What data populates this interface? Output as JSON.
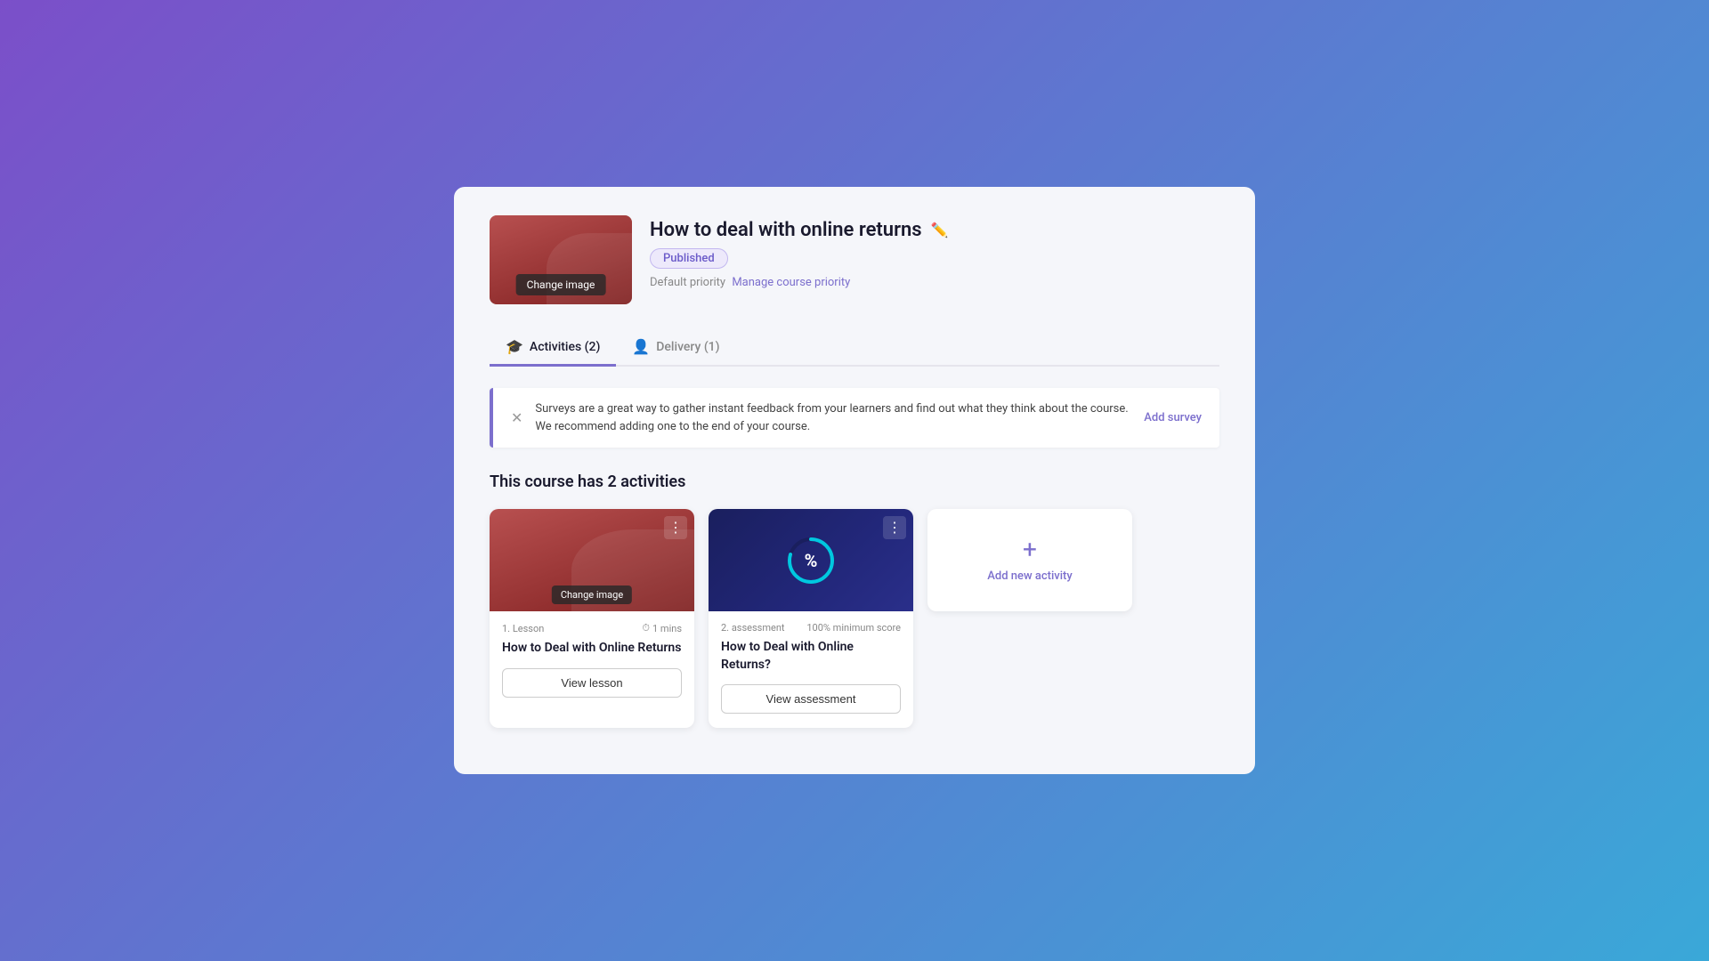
{
  "page": {
    "background": "gradient-purple-blue"
  },
  "course": {
    "title": "How to deal with online returns",
    "status": "Published",
    "priority_label": "Default priority",
    "manage_priority_text": "Manage course priority",
    "change_image_label": "Change image"
  },
  "tabs": [
    {
      "id": "activities",
      "label": "Activities (2)",
      "icon": "🎓",
      "active": true
    },
    {
      "id": "delivery",
      "label": "Delivery (1)",
      "icon": "👤",
      "active": false
    }
  ],
  "banner": {
    "text": "Surveys are a great way to gather instant feedback from your learners and find out what they think about the course. We recommend adding one to the end of your course.",
    "action_label": "Add survey"
  },
  "section_title": "This course has 2 activities",
  "activities": [
    {
      "id": 1,
      "type": "Lesson",
      "number": "1.",
      "duration": "1 mins",
      "title": "How to Deal with Online Returns",
      "button_label": "View lesson",
      "image_type": "lesson",
      "change_image_label": "Change image"
    },
    {
      "id": 2,
      "type": "assessment",
      "number": "2.",
      "score_label": "100% minimum score",
      "title": "How to Deal with Online Returns?",
      "button_label": "View assessment",
      "image_type": "assessment"
    }
  ],
  "add_activity": {
    "icon": "+",
    "label": "Add new activity"
  }
}
